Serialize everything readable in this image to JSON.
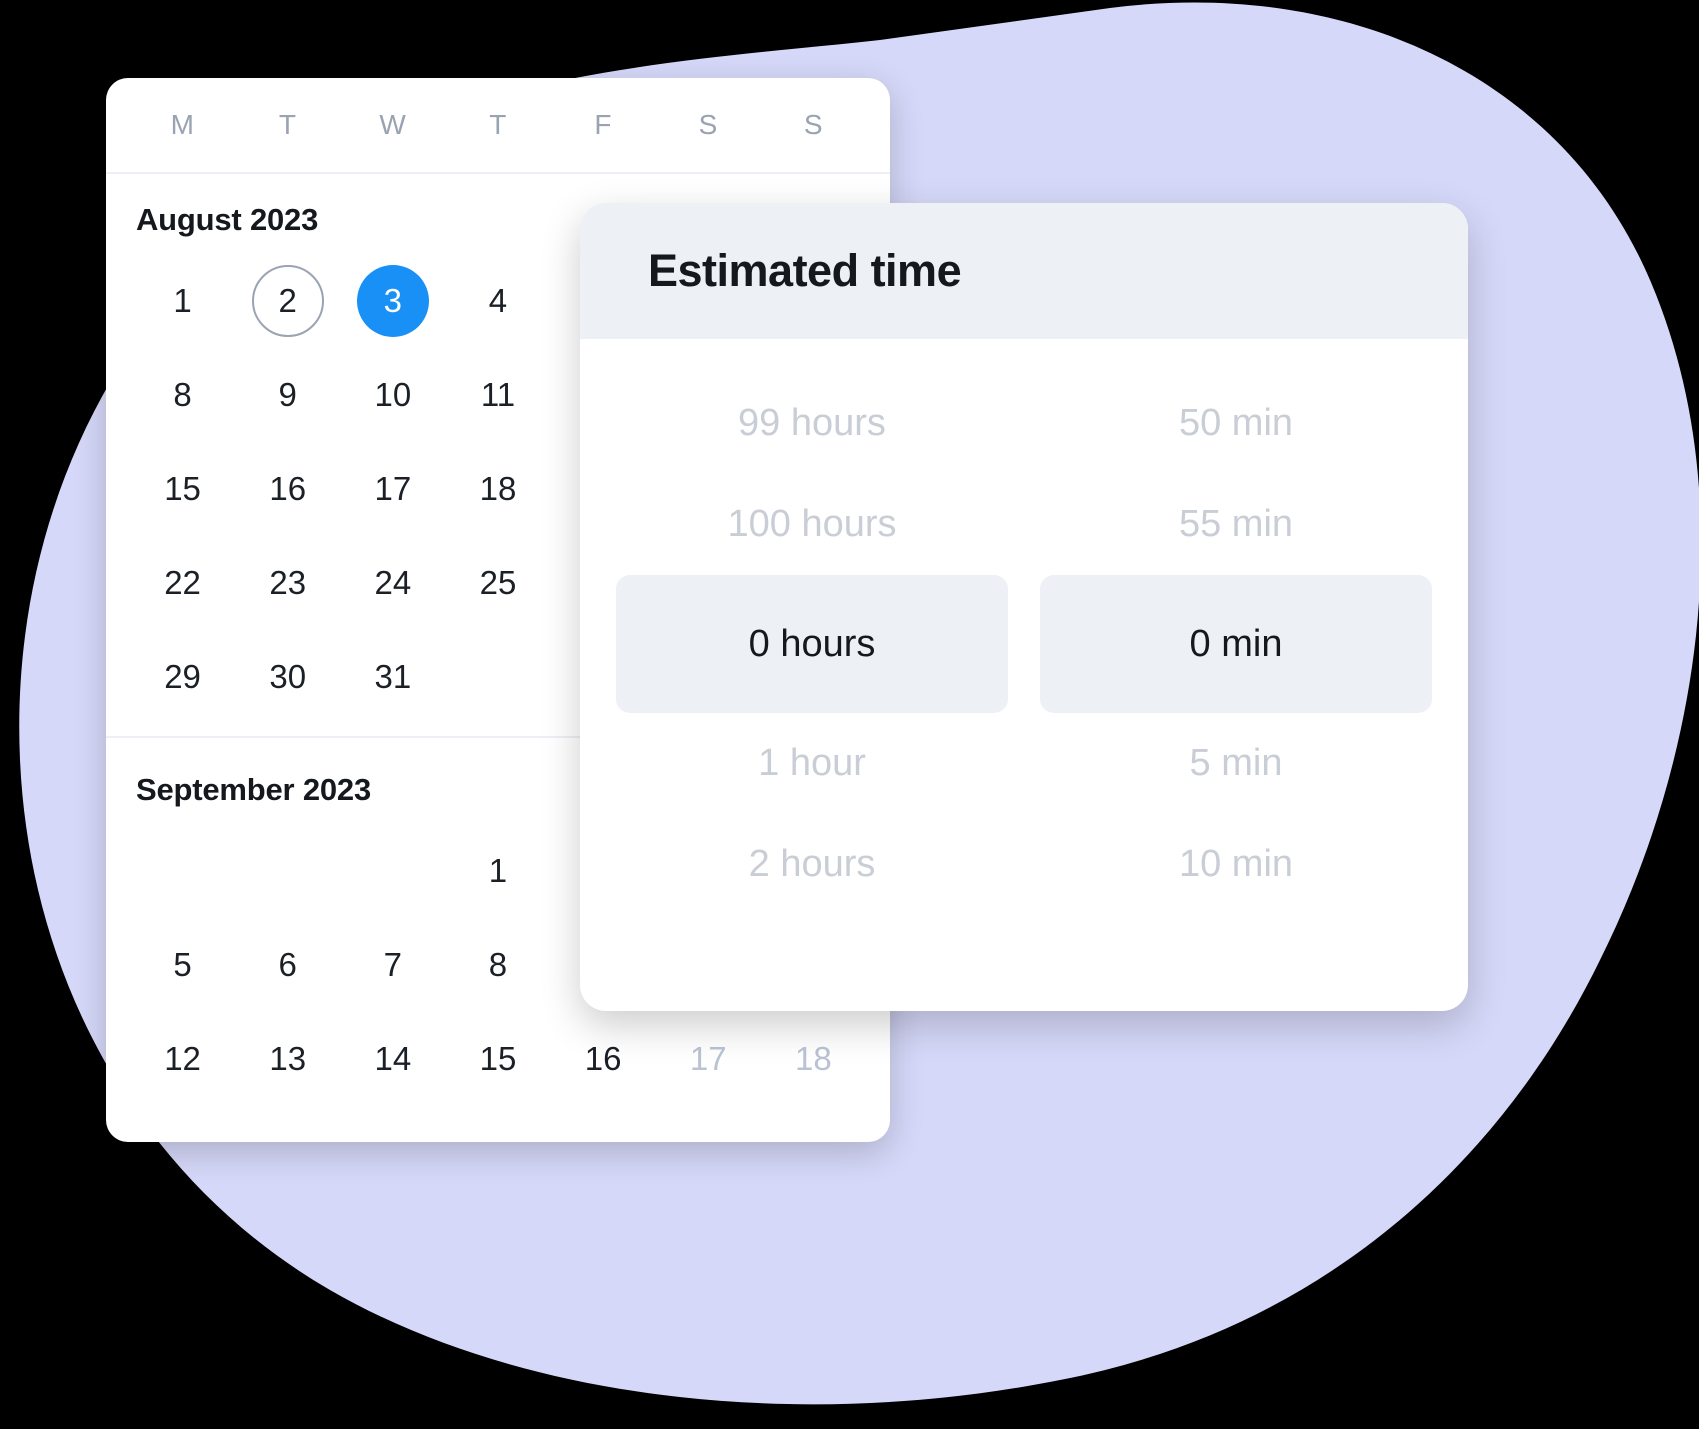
{
  "background": {
    "blob_color": "#d6d8f9",
    "canvas_color": "#000000"
  },
  "calendar": {
    "weekdays": [
      "M",
      "T",
      "W",
      "T",
      "F",
      "S",
      "S"
    ],
    "accent_color": "#1890f5",
    "months": [
      {
        "title": "August 2023",
        "weeks": [
          [
            {
              "label": "1",
              "state": "normal"
            },
            {
              "label": "2",
              "state": "today"
            },
            {
              "label": "3",
              "state": "selected"
            },
            {
              "label": "4",
              "state": "normal"
            },
            {
              "label": "",
              "state": "empty"
            },
            {
              "label": "",
              "state": "empty"
            },
            {
              "label": "",
              "state": "empty"
            }
          ],
          [
            {
              "label": "8",
              "state": "normal"
            },
            {
              "label": "9",
              "state": "normal"
            },
            {
              "label": "10",
              "state": "normal"
            },
            {
              "label": "11",
              "state": "normal"
            },
            {
              "label": "",
              "state": "empty"
            },
            {
              "label": "",
              "state": "empty"
            },
            {
              "label": "",
              "state": "empty"
            }
          ],
          [
            {
              "label": "15",
              "state": "normal"
            },
            {
              "label": "16",
              "state": "normal"
            },
            {
              "label": "17",
              "state": "normal"
            },
            {
              "label": "18",
              "state": "normal"
            },
            {
              "label": "",
              "state": "empty"
            },
            {
              "label": "",
              "state": "empty"
            },
            {
              "label": "",
              "state": "empty"
            }
          ],
          [
            {
              "label": "22",
              "state": "normal"
            },
            {
              "label": "23",
              "state": "normal"
            },
            {
              "label": "24",
              "state": "normal"
            },
            {
              "label": "25",
              "state": "normal"
            },
            {
              "label": "",
              "state": "empty"
            },
            {
              "label": "",
              "state": "empty"
            },
            {
              "label": "",
              "state": "empty"
            }
          ],
          [
            {
              "label": "29",
              "state": "normal"
            },
            {
              "label": "30",
              "state": "normal"
            },
            {
              "label": "31",
              "state": "normal"
            },
            {
              "label": "",
              "state": "empty"
            },
            {
              "label": "",
              "state": "empty"
            },
            {
              "label": "",
              "state": "empty"
            },
            {
              "label": "",
              "state": "empty"
            }
          ]
        ]
      },
      {
        "title": "September 2023",
        "weeks": [
          [
            {
              "label": "",
              "state": "empty"
            },
            {
              "label": "",
              "state": "empty"
            },
            {
              "label": "",
              "state": "empty"
            },
            {
              "label": "1",
              "state": "normal"
            },
            {
              "label": "",
              "state": "empty"
            },
            {
              "label": "",
              "state": "empty"
            },
            {
              "label": "",
              "state": "empty"
            }
          ],
          [
            {
              "label": "5",
              "state": "normal"
            },
            {
              "label": "6",
              "state": "normal"
            },
            {
              "label": "7",
              "state": "normal"
            },
            {
              "label": "8",
              "state": "normal"
            },
            {
              "label": "",
              "state": "empty"
            },
            {
              "label": "",
              "state": "empty"
            },
            {
              "label": "",
              "state": "empty"
            }
          ],
          [
            {
              "label": "12",
              "state": "normal"
            },
            {
              "label": "13",
              "state": "normal"
            },
            {
              "label": "14",
              "state": "normal"
            },
            {
              "label": "15",
              "state": "normal"
            },
            {
              "label": "16",
              "state": "normal"
            },
            {
              "label": "17",
              "state": "muted"
            },
            {
              "label": "18",
              "state": "muted"
            }
          ]
        ]
      }
    ]
  },
  "estimated_time_dialog": {
    "title": "Estimated time",
    "hours_column": [
      {
        "label": "99 hours",
        "selected": false
      },
      {
        "label": "100 hours",
        "selected": false
      },
      {
        "label": "0 hours",
        "selected": true
      },
      {
        "label": "1 hour",
        "selected": false
      },
      {
        "label": "2 hours",
        "selected": false
      }
    ],
    "minutes_column": [
      {
        "label": "50 min",
        "selected": false
      },
      {
        "label": "55 min",
        "selected": false
      },
      {
        "label": "0 min",
        "selected": true
      },
      {
        "label": "5 min",
        "selected": false
      },
      {
        "label": "10 min",
        "selected": false
      }
    ]
  }
}
